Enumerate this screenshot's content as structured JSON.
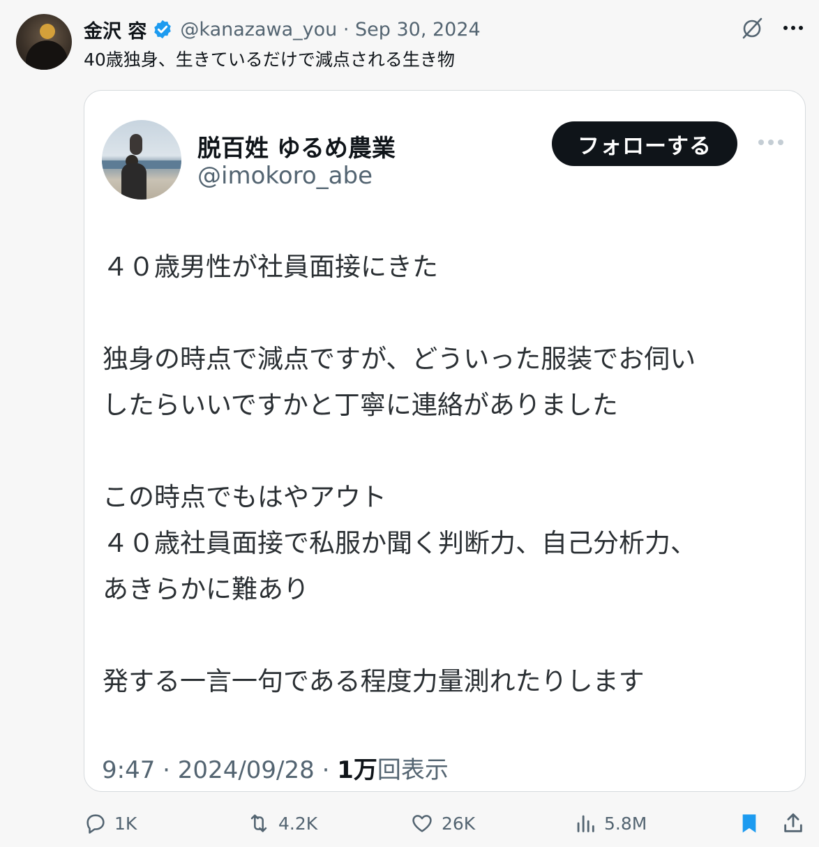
{
  "post": {
    "author_name": "金沢 容",
    "handle": "@kanazawa_you",
    "separator": "·",
    "date": "Sep 30, 2024",
    "text": "40歳独身、生きているだけで減点される生き物",
    "verified": true
  },
  "quote": {
    "author_name": "脱百姓 ゆるめ農業",
    "handle": "@imokoro_abe",
    "follow_label": "フォローする",
    "lines": [
      "４０歳男性が社員面接にきた",
      "",
      "独身の時点で減点ですが、どういった服装でお伺い",
      "したらいいですかと丁寧に連絡がありました",
      "",
      "この時点でもはやアウト",
      "４０歳社員面接で私服か聞く判断力、自己分析力、",
      "あきらかに難あり",
      "",
      "発する一言一句である程度力量測れたりします"
    ],
    "time": "9:47",
    "date": "2024/09/28",
    "views_count": "1万",
    "views_label": "回表示"
  },
  "actions": {
    "replies": "1K",
    "reposts": "4.2K",
    "likes": "26K",
    "views": "5.8M"
  },
  "icons": {
    "top": [
      "grok-icon",
      "more-icon"
    ],
    "bottom": [
      "reply-icon",
      "repost-icon",
      "like-icon",
      "views-icon",
      "bookmark-icon",
      "share-icon"
    ]
  },
  "colors": {
    "accent": "#1d9bf0",
    "text": "#0f1419",
    "secondary": "#536471",
    "follow_button": "#0f1419"
  }
}
